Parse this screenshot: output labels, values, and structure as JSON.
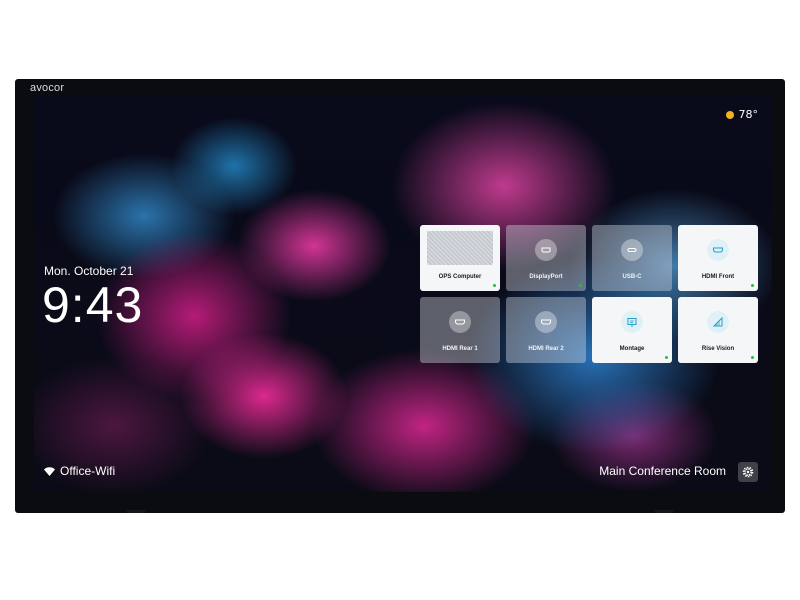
{
  "brand": "avocor",
  "weather": {
    "icon": "sun-icon",
    "temperature": "78°"
  },
  "clock": {
    "date": "Mon. October 21",
    "time": "9:43"
  },
  "sources": [
    {
      "label": "OPS Computer",
      "icon": "monitor-preview",
      "active": true,
      "selected": true
    },
    {
      "label": "DisplayPort",
      "icon": "displayport-icon",
      "active": true,
      "selected": false
    },
    {
      "label": "USB-C",
      "icon": "usb-c-icon",
      "active": false,
      "selected": false
    },
    {
      "label": "HDMI Front",
      "icon": "hdmi-icon",
      "active": true,
      "selected": false
    },
    {
      "label": "HDMI Rear 1",
      "icon": "hdmi-icon",
      "active": false,
      "selected": false
    },
    {
      "label": "HDMI Rear 2",
      "icon": "hdmi-icon",
      "active": false,
      "selected": false
    },
    {
      "label": "Montage",
      "icon": "montage-icon",
      "active": true,
      "selected": false
    },
    {
      "label": "Rise Vision",
      "icon": "rise-vision-icon",
      "active": true,
      "selected": false
    }
  ],
  "network": {
    "icon": "wifi-icon",
    "name": "Office-Wifi"
  },
  "room": {
    "name": "Main Conference Room"
  },
  "settings": {
    "icon": "gear-icon"
  },
  "colors": {
    "accent": "#37b24d",
    "sun": "#f2b21d"
  }
}
